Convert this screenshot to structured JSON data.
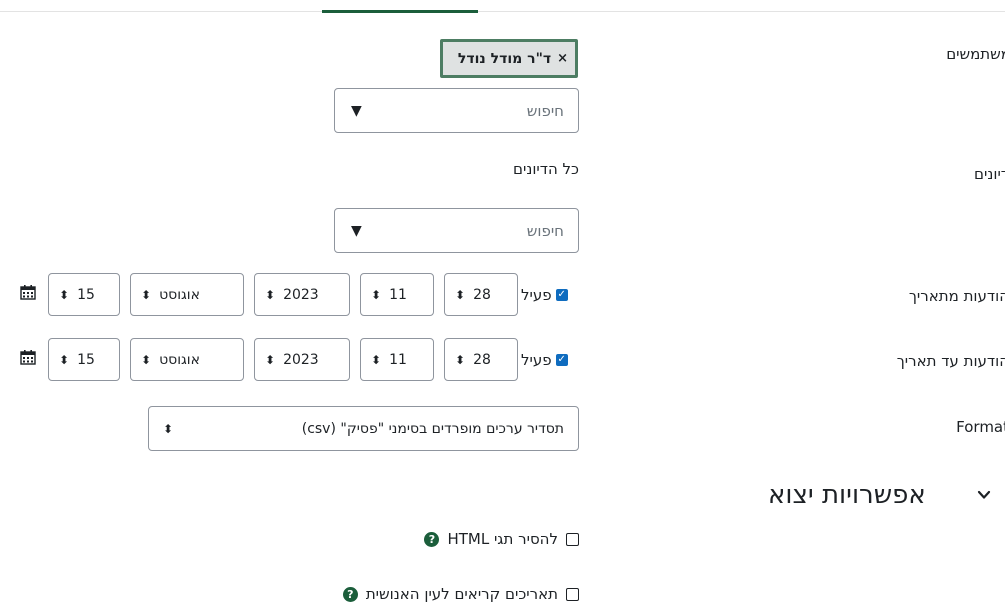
{
  "labels": {
    "users": "משתמשים",
    "discussions": "דיונים",
    "from_date": "הודעות מתאריך",
    "to_date": "הודעות עד תאריך",
    "format": "Format"
  },
  "users_field": {
    "chip_label": "ד\"ר מודל נודל",
    "chip_remove": "×",
    "search_placeholder": "חיפוש",
    "dropdown_icon": "▼"
  },
  "discussions_field": {
    "selected": "כל הדיונים",
    "search_placeholder": "חיפוש",
    "dropdown_icon": "▼"
  },
  "from_date": {
    "enabled_label": "פעיל",
    "enabled": true,
    "day": "28",
    "hour": "11",
    "year": "2023",
    "month": "אוגוסט",
    "minute": "15"
  },
  "to_date": {
    "enabled_label": "פעיל",
    "enabled": true,
    "day": "28",
    "hour": "11",
    "year": "2023",
    "month": "אוגוסט",
    "minute": "15"
  },
  "format_select": {
    "value": "תסדיר ערכים מופרדים בסימני \"פסיק\" (csv)"
  },
  "output_options": {
    "title": "אפשרויות יצוא",
    "strip_html_label": "להסיר תגי HTML",
    "human_dates_label": "תאריכים קריאים לעין האנושית"
  },
  "icons": {
    "stepper": "⬍",
    "calendar": "calendar-icon",
    "checkmark": "✓",
    "help": "?"
  },
  "colors": {
    "accent_green": "#1b5e3b",
    "chip_border": "#4d7d63",
    "checkbox_blue": "#0f6cbf"
  }
}
